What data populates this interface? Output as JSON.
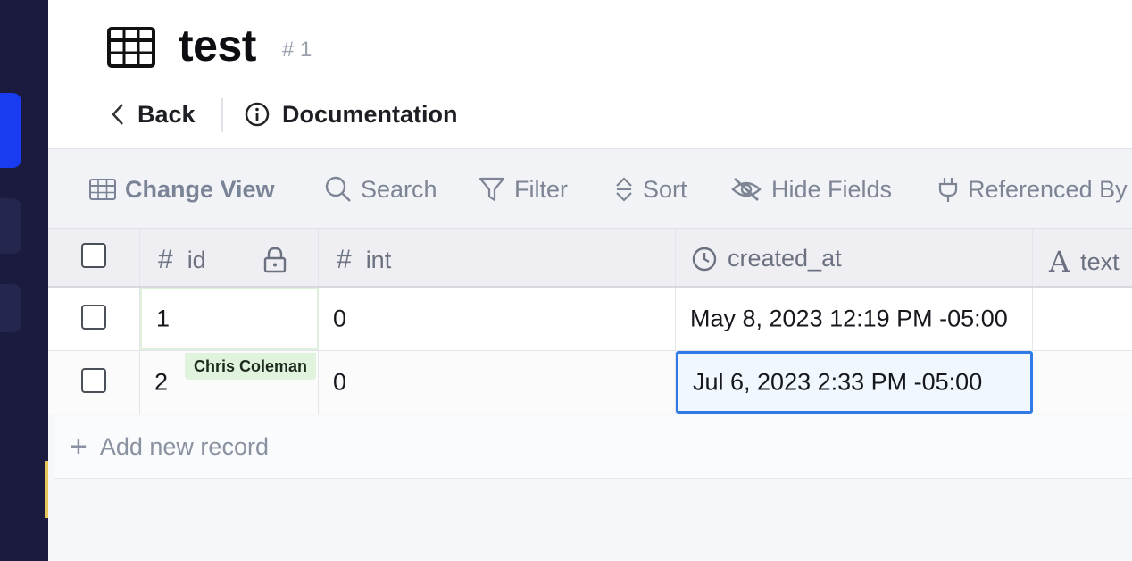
{
  "header": {
    "title": "test",
    "table_id": "# 1",
    "back_label": "Back",
    "docs_label": "Documentation"
  },
  "toolbar": {
    "change_view": "Change View",
    "search": "Search",
    "filter": "Filter",
    "sort": "Sort",
    "hide_fields": "Hide Fields",
    "referenced_by": "Referenced By"
  },
  "columns": [
    {
      "name": "id",
      "icon": "hash-icon",
      "locked": true
    },
    {
      "name": "int",
      "icon": "hash-icon"
    },
    {
      "name": "created_at",
      "icon": "clock-icon"
    },
    {
      "name": "text",
      "icon": "text-type-icon"
    }
  ],
  "rows": [
    {
      "id": "1",
      "int": "0",
      "created_at": "May 8, 2023 12:19 PM -05:00"
    },
    {
      "id": "2",
      "int": "0",
      "created_at": "Jul 6, 2023 2:33 PM -05:00"
    }
  ],
  "collaborator": {
    "name": "Chris Coleman"
  },
  "add_record_label": "Add new record",
  "colors": {
    "sidebar_bg": "#1a1b3f",
    "sidebar_active": "#1a3cf0",
    "selection_border": "#2f7ae5",
    "collaborator_bg": "#dff3dd"
  }
}
